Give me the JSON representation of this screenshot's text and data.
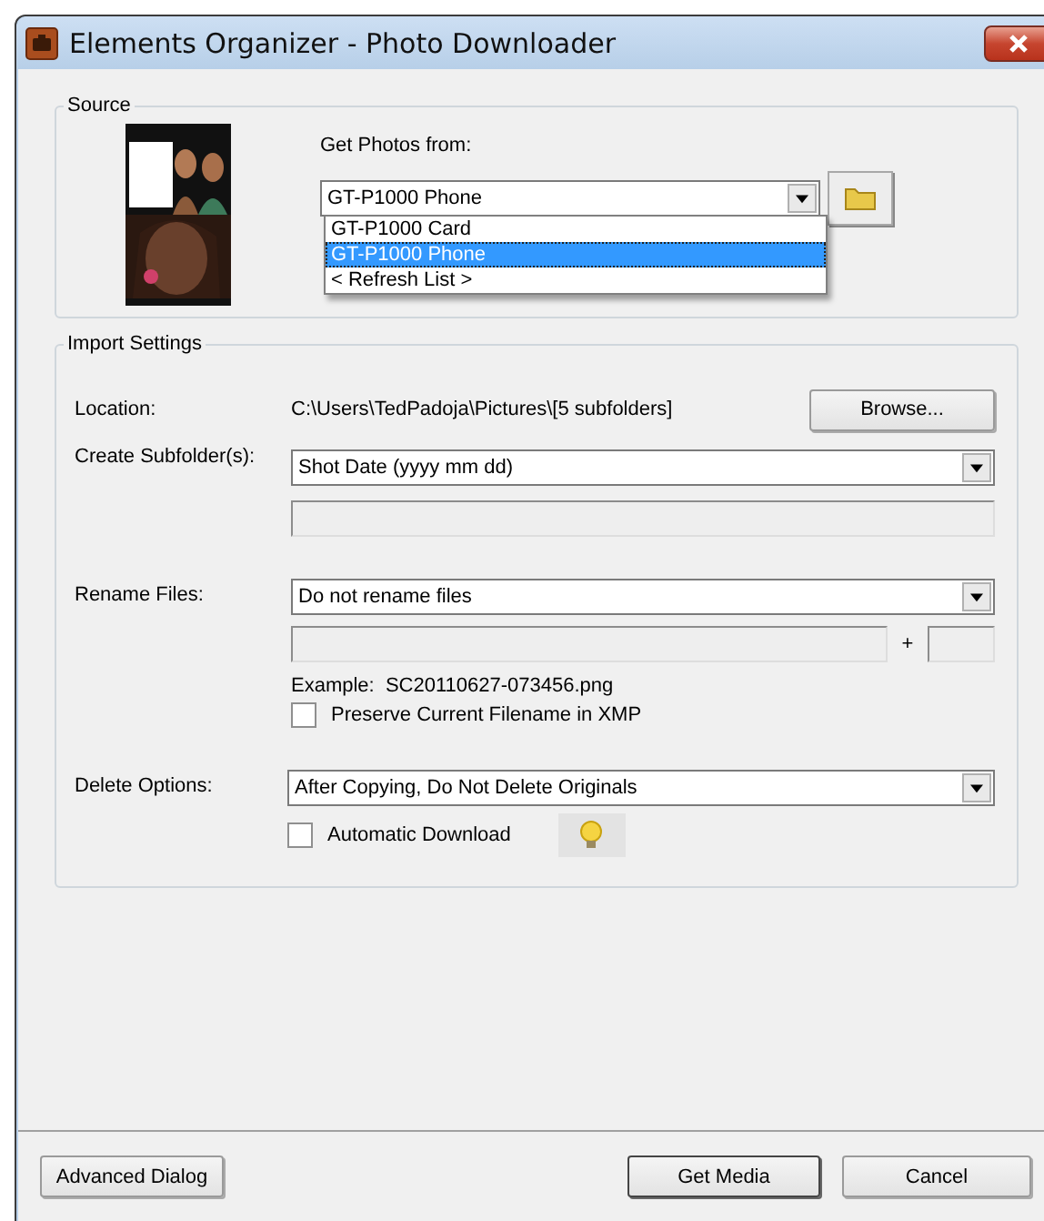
{
  "window": {
    "title": "Elements Organizer - Photo Downloader"
  },
  "source": {
    "label": "Source",
    "get_from_label": "Get Photos from:",
    "device": {
      "value": "GT-P1000 Phone",
      "open": true,
      "options": [
        {
          "label": "GT-P1000 Card",
          "selected": false
        },
        {
          "label": "GT-P1000 Phone",
          "selected": true
        },
        {
          "label": "< Refresh List >",
          "selected": false
        }
      ]
    }
  },
  "import_settings": {
    "label": "Import Settings",
    "location": {
      "label": "Location:",
      "path": "C:\\Users\\TedPadoja\\Pictures\\[5 subfolders]",
      "button": "Browse..."
    },
    "subfolders": {
      "label": "Create Subfolder(s):",
      "value": "Shot Date (yyyy mm dd)",
      "custom_disabled": true
    },
    "rename": {
      "label": "Rename Files:",
      "value": "Do not rename files",
      "plus": "+",
      "custom_disabled": true,
      "example": "Example:  SC20110627-073456.png",
      "preserve": {
        "label": "Preserve Current Filename in XMP",
        "checked": false
      }
    },
    "delete": {
      "label": "Delete Options:",
      "value": "After Copying, Do Not Delete Originals"
    },
    "auto_download": {
      "label": "Automatic Download",
      "checked": false
    }
  },
  "buttons": [
    {
      "label": "Advanced Dialog",
      "default": false
    },
    {
      "label": "Get Media",
      "default": true
    },
    {
      "label": "Cancel",
      "default": false
    }
  ]
}
